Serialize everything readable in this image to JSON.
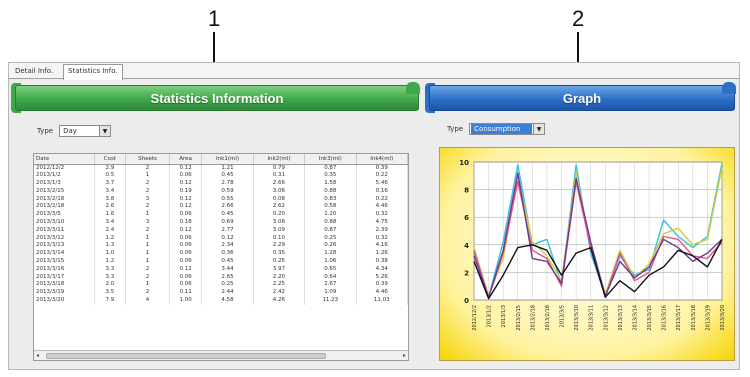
{
  "callouts": [
    "1",
    "2"
  ],
  "tabs": [
    "Detail Info.",
    "Statistics Info."
  ],
  "stats_panel": {
    "title": "Statistics Information",
    "type_label": "Type",
    "type_value": "Day",
    "columns": [
      "Date",
      "Cost",
      "Sheets",
      "Area",
      "Ink1(ml)",
      "Ink2(ml)",
      "Ink3(ml)",
      "Ink4(ml)"
    ],
    "rows": [
      [
        "2012/12/2",
        "2.9",
        "2",
        "0.12",
        "1.21",
        "0.79",
        "0.87",
        "0.39"
      ],
      [
        "2013/1/2",
        "0.5",
        "1",
        "0.06",
        "0.45",
        "0.31",
        "0.35",
        "0.22"
      ],
      [
        "2013/1/3",
        "3.7",
        "2",
        "0.12",
        "2.78",
        "2.66",
        "1.58",
        "5.46"
      ],
      [
        "2013/2/15",
        "3.4",
        "2",
        "0.19",
        "0.59",
        "3.06",
        "0.88",
        "0.16"
      ],
      [
        "2013/2/18",
        "3.8",
        "3",
        "0.12",
        "0.55",
        "0.08",
        "0.83",
        "0.22"
      ],
      [
        "2013/2/18",
        "2.6",
        "2",
        "0.12",
        "2.66",
        "2.62",
        "0.58",
        "4.46"
      ],
      [
        "2013/3/5",
        "1.6",
        "1",
        "0.06",
        "0.45",
        "0.20",
        "1.20",
        "0.32"
      ],
      [
        "2013/3/10",
        "3.4",
        "3",
        "0.18",
        "0.69",
        "3.06",
        "0.88",
        "4.75"
      ],
      [
        "2013/3/11",
        "2.4",
        "2",
        "0.12",
        "2.77",
        "3.09",
        "0.87",
        "2.39"
      ],
      [
        "2013/3/12",
        "1.2",
        "1",
        "0.06",
        "0.12",
        "0.10",
        "0.25",
        "0.32"
      ],
      [
        "2013/3/13",
        "1.3",
        "1",
        "0.06",
        "2.34",
        "2.29",
        "0.26",
        "4.16"
      ],
      [
        "2013/3/14",
        "1.0",
        "1",
        "0.06",
        "0.36",
        "0.35",
        "1.28",
        "1.26"
      ],
      [
        "2013/3/15",
        "1.2",
        "1",
        "0.06",
        "0.45",
        "0.25",
        "1.06",
        "0.38"
      ],
      [
        "2013/3/16",
        "3.3",
        "2",
        "0.12",
        "3.44",
        "3.97",
        "0.65",
        "4.34"
      ],
      [
        "2013/3/17",
        "3.3",
        "2",
        "0.06",
        "2.65",
        "2.20",
        "0.64",
        "5.26"
      ],
      [
        "2013/3/18",
        "2.0",
        "1",
        "0.06",
        "0.25",
        "2.25",
        "2.67",
        "0.39"
      ],
      [
        "2013/3/19",
        "3.5",
        "2",
        "0.11",
        "2.44",
        "2.42",
        "1.09",
        "4.46"
      ],
      [
        "2013/3/20",
        "7.9",
        "4",
        "1.00",
        "4.58",
        "4.26",
        "11.23",
        "11.03"
      ]
    ]
  },
  "graph_panel": {
    "title": "Graph",
    "type_label": "Type",
    "type_value": "Consumption"
  },
  "chart_data": {
    "type": "line",
    "title": "",
    "xlabel": "",
    "ylabel": "",
    "ylim": [
      0,
      10
    ],
    "yticks": [
      "0",
      "2",
      "4",
      "6",
      "8",
      "10"
    ],
    "categories": [
      "2012/12/2",
      "2013/1/2",
      "2013/1/3",
      "2013/2/15",
      "2013/2/18",
      "2013/2/18",
      "2013/3/5",
      "2013/3/10",
      "2013/3/11",
      "2013/3/12",
      "2013/3/13",
      "2013/3/14",
      "2013/3/15",
      "2013/3/16",
      "2013/3/17",
      "2013/3/18",
      "2013/3/19",
      "2013/3/20"
    ],
    "grid": true,
    "series": [
      {
        "color": "#35c0d8",
        "values": [
          3.4,
          0.2,
          4.2,
          9.8,
          4.0,
          4.4,
          1.2,
          9.8,
          3.4,
          0.3,
          3.2,
          1.8,
          2.2,
          5.8,
          4.6,
          3.8,
          4.6,
          9.9
        ]
      },
      {
        "color": "#c8d23a",
        "values": [
          3.8,
          0.3,
          3.0,
          9.0,
          4.2,
          3.2,
          1.4,
          9.2,
          4.0,
          0.4,
          3.6,
          1.6,
          2.6,
          4.8,
          5.2,
          4.0,
          4.4,
          9.6
        ]
      },
      {
        "color": "#e8508a",
        "values": [
          3.6,
          0.2,
          3.4,
          8.6,
          3.6,
          3.0,
          1.0,
          8.6,
          3.8,
          0.2,
          3.4,
          1.4,
          2.0,
          4.6,
          4.4,
          3.2,
          3.0,
          4.2
        ]
      },
      {
        "color": "#6a3a9a",
        "values": [
          3.2,
          0.2,
          3.6,
          9.2,
          3.0,
          2.8,
          1.2,
          8.8,
          4.2,
          0.3,
          2.8,
          1.6,
          2.4,
          4.4,
          3.8,
          2.8,
          3.4,
          4.4
        ]
      },
      {
        "color": "#111111",
        "values": [
          2.8,
          0.1,
          1.8,
          3.8,
          4.0,
          3.6,
          1.8,
          3.4,
          3.8,
          0.2,
          1.4,
          0.6,
          1.8,
          2.4,
          3.6,
          3.2,
          2.4,
          4.4
        ]
      }
    ]
  }
}
